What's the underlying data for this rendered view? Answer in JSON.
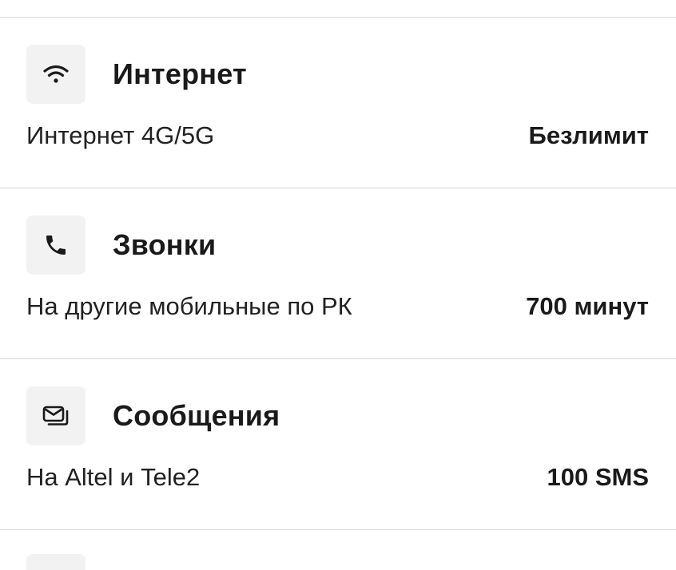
{
  "sections": [
    {
      "icon": "wifi-icon",
      "title": "Интернет",
      "label": "Интернет 4G/5G",
      "value": "Безлимит"
    },
    {
      "icon": "phone-icon",
      "title": "Звонки",
      "label": "На другие мобильные по РК",
      "value": "700 минут"
    },
    {
      "icon": "messages-icon",
      "title": "Сообщения",
      "label": "На Altel и Tele2",
      "value": "100 SMS"
    }
  ]
}
